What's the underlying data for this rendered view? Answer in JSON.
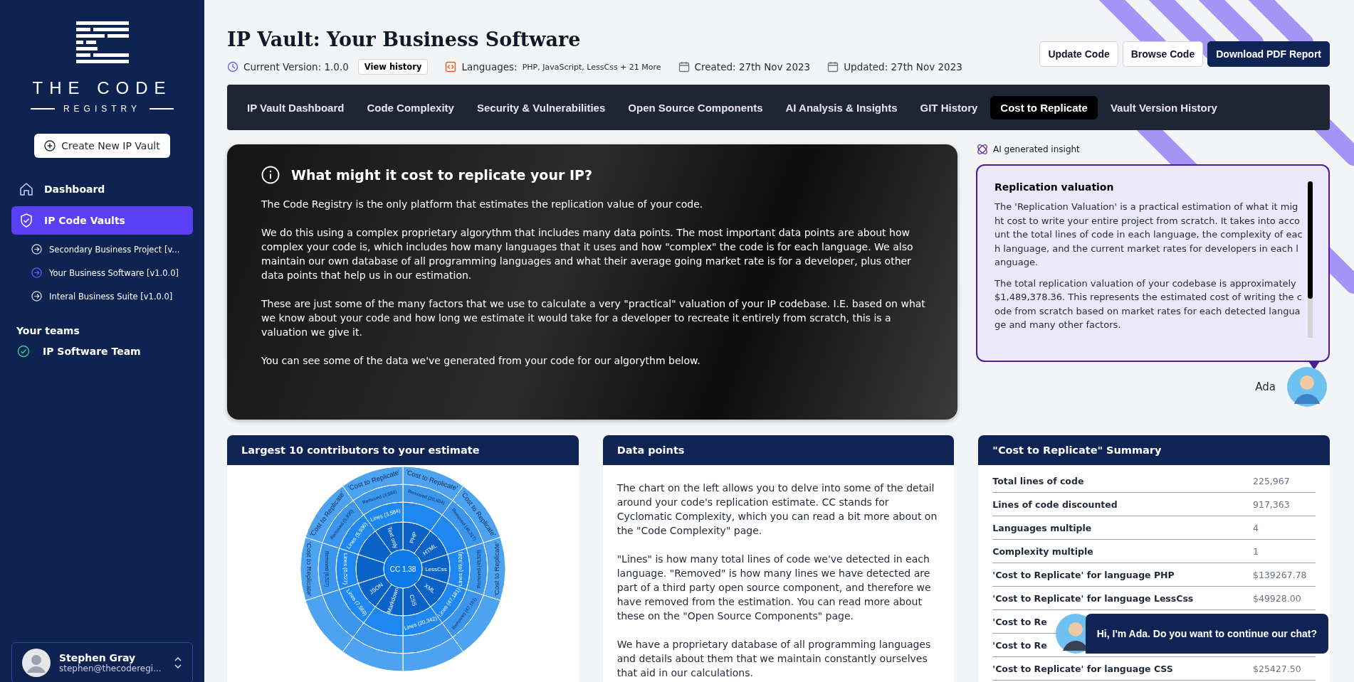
{
  "sidebar": {
    "logo": {
      "line_1": "THE CODE",
      "line_2": "REGISTRY"
    },
    "create_button": "Create New IP Vault",
    "nav": [
      {
        "label": "Dashboard",
        "selected": false
      },
      {
        "label": "IP Code Vaults",
        "selected": true
      }
    ],
    "vaults": [
      {
        "label": "Secondary Business Project [v...",
        "selected": false
      },
      {
        "label": "Your Business Software [v1.0.0]",
        "selected": true
      },
      {
        "label": "Interal Business Suite [v1.0.0]",
        "selected": false
      }
    ],
    "teams_heading": "Your teams",
    "teams": [
      {
        "label": "IP Software Team"
      }
    ],
    "user": {
      "name": "Stephen Gray",
      "email": "stephen@thecoderegi..."
    }
  },
  "header": {
    "title": "IP Vault: Your Business Software",
    "meta": [
      {
        "kind": "version",
        "label": "Current Version: 1.0.0",
        "button": "View history"
      },
      {
        "kind": "languages",
        "label": "Languages:",
        "value": "PHP, JavaScript, LessCss + 21 More"
      },
      {
        "kind": "date",
        "label": "Created: 27th Nov 2023"
      },
      {
        "kind": "date",
        "label": "Updated: 27th Nov 2023"
      }
    ],
    "buttons": [
      {
        "label": "Update Code",
        "primary": false
      },
      {
        "label": "Browse Code",
        "primary": false
      },
      {
        "label": "Download PDF Report",
        "primary": true
      }
    ]
  },
  "tabs": [
    {
      "label": "IP Vault Dashboard",
      "selected": false
    },
    {
      "label": "Code Complexity",
      "selected": false
    },
    {
      "label": "Security & Vulnerabilities",
      "selected": false
    },
    {
      "label": "Open Source Components",
      "selected": false
    },
    {
      "label": "AI Analysis & Insights",
      "selected": false
    },
    {
      "label": "GIT History",
      "selected": false
    },
    {
      "label": "Cost to Replicate",
      "selected": true
    },
    {
      "label": "Vault Version History",
      "selected": false
    }
  ],
  "hero": {
    "title": "What might it cost to replicate your IP?",
    "paragraphs": [
      "The Code Registry is the only platform that estimates the replication value of your code.",
      "We do this using a complex proprietary algorythm that includes many data points. The most important data points are about how complex your code is, which includes how many languages that it uses and how \"complex\" the code is for each language. We also maintain our own database of all programming languages and what their average going market rate is for a developer, plus other data points that help us in our estimation.",
      "These are just some of the many factors that we use to calculate a very \"practical\" valuation of your IP codebase. I.E. based on what we know about your code and how long we estimate it would take for a developer to recreate it entirely from scratch, this is a valuation we give it.",
      "You can see some of the data we've generated from your code for our algorythm below."
    ]
  },
  "insight": {
    "label": "AI generated insight",
    "title": "Replication valuation",
    "paragraphs": [
      "The 'Replication Valuation' is a practical estimation of what it might cost to write your entire project from scratch. It takes into account the total lines of code in each language, the complexity of each language, and the current market rates for developers in each language.",
      "The total replication valuation of your codebase is approximately $1,489,378.36. This represents the estimated cost of writing the code from scratch based on market rates for each detected language and many other factors."
    ],
    "assistant": "Ada"
  },
  "contributors": {
    "title": "Largest 10 contributors to your estimate",
    "center_label": "CC 1.38",
    "segments": [
      {
        "language": "PHP",
        "removed": "Removed (20,604)",
        "outer": "'Cost to Replicate'"
      },
      {
        "language": "HTML",
        "removed": "Removed (48,317)",
        "outer": "'Cost to Replicate'"
      },
      {
        "language": "LessCss",
        "lines": "Lines (49,928)",
        "removed": "Removed (49,928)",
        "outer": "'Cost to Replicate'"
      },
      {
        "language": "XML",
        "lines": "Lines (47,181)",
        "removed": "Removed (47,181)"
      },
      {
        "language": "CSS",
        "lines": "Lines (20,342)"
      },
      {
        "language": "Markdown"
      },
      {
        "language": "JSON",
        "lines": "Lines (7,569)"
      },
      {
        "lines": "Lines (6,527)",
        "removed": "Removed (6,527)",
        "outer": "'Cost to Replicate'"
      },
      {
        "lines": "Lines (5,936)",
        "removed": "Removed (5,936)",
        "outer": "'Cost to Replicate'"
      },
      {
        "language": "Text only",
        "lines": "Lines (3,584)",
        "removed": "Removed (3,584)",
        "outer": "'Cost to Replicate'"
      }
    ]
  },
  "data_points": {
    "title": "Data points",
    "paragraphs": [
      "The chart on the left allows you to delve into some of the detail around your code's replication estimate. CC stands for Cyclomatic Complexity, which you can read a bit more about on the \"Code Complexity\" page.",
      "\"Lines\" is how many total lines of code we've detected in each language. \"Removed\" is how many lines we have detected are part of a third party open source component, and therefore we have removed from the estimation. You can read more about these on the \"Open Source Components\" page.",
      "We have a proprietary database of all programming languages and details about them that we maintain constantly ourselves that aid in our calculations."
    ]
  },
  "summary": {
    "title": "\"Cost to Replicate\" Summary",
    "rows": [
      {
        "label": "Total lines of code",
        "value": "225,967"
      },
      {
        "label": "Lines of code discounted",
        "value": "917,363"
      },
      {
        "label": "Languages multiple",
        "value": "4"
      },
      {
        "label": "Complexity multiple",
        "value": "1"
      },
      {
        "label": "'Cost to Replicate' for language PHP",
        "value": "$139267.78"
      },
      {
        "label": "'Cost to Replicate' for language LessCss",
        "value": "$49928.00"
      },
      {
        "label": "'Cost to Re"
      },
      {
        "label": "'Cost to Re"
      },
      {
        "label": "'Cost to Replicate' for language CSS",
        "value": "$25427.50"
      }
    ]
  },
  "chat_popup": {
    "message": "Hi, I'm Ada. Do you want to continue our chat?"
  }
}
